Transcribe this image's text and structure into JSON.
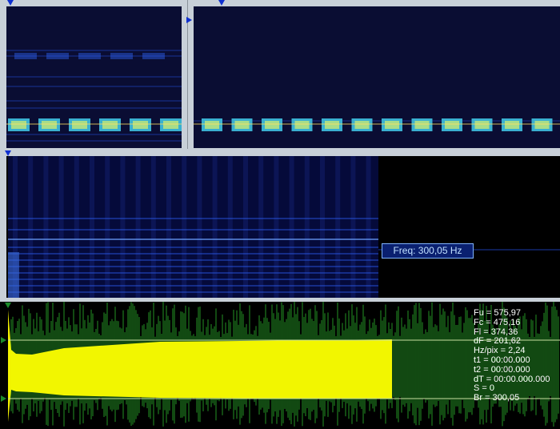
{
  "freq_label": "Freq: 300,05 Hz",
  "readout": {
    "fu": "Fu = 575,97",
    "fc": "Fc = 475,16",
    "fl": "Fl = 374,36",
    "df": "dF = 201,62",
    "hzpix": "Hz/pix = 2,24",
    "t1": "t1 = 00:00.000",
    "t2": "t2 = 00:00.000",
    "dt": "dT = 00:00.000.000",
    "s": "S = 0",
    "br": "Br = 300,05"
  },
  "colors": {
    "spectrogram_bg": "#0a0d33",
    "signal": "#ffff00",
    "waveform": "#1e7a1e",
    "marker_blue": "#1030d0",
    "marker_green": "#1b8a2a"
  }
}
